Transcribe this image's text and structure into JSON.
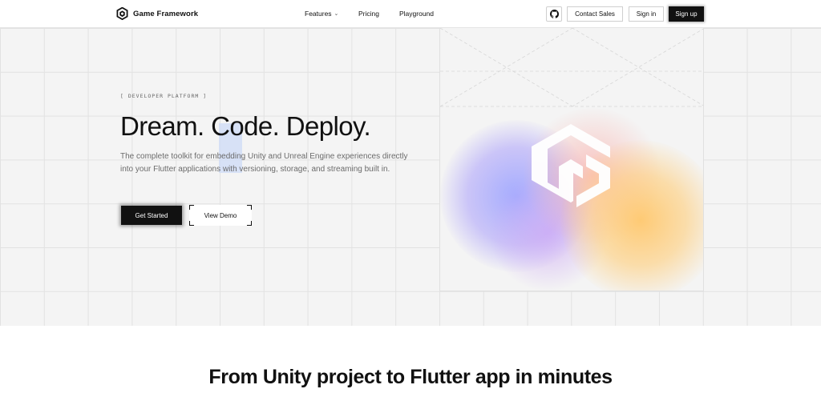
{
  "nav": {
    "brand": "Game Framework",
    "links": [
      {
        "label": "Features",
        "has_dropdown": true
      },
      {
        "label": "Pricing"
      },
      {
        "label": "Playground"
      }
    ],
    "github_icon": "github-icon",
    "contact_label": "Contact Sales",
    "signin_label": "Sign in",
    "signup_label": "Sign up"
  },
  "hero": {
    "eyebrow": "[ DEVELOPER PLATFORM ]",
    "headline": "Dream. Code. Deploy.",
    "subtitle": "The complete toolkit for embedding Unity and Unreal Engine experiences directly into your Flutter applications with versioning, storage, and streaming built in.",
    "primary_cta": "Get Started",
    "secondary_cta": "View Demo"
  },
  "section2": {
    "title": "From Unity project to Flutter app in minutes"
  },
  "colors": {
    "accent_dark": "#111111",
    "hero_bg": "#f4f4f4",
    "blob_blue": "#a0a8ff",
    "blob_orange": "#ffc86e"
  }
}
